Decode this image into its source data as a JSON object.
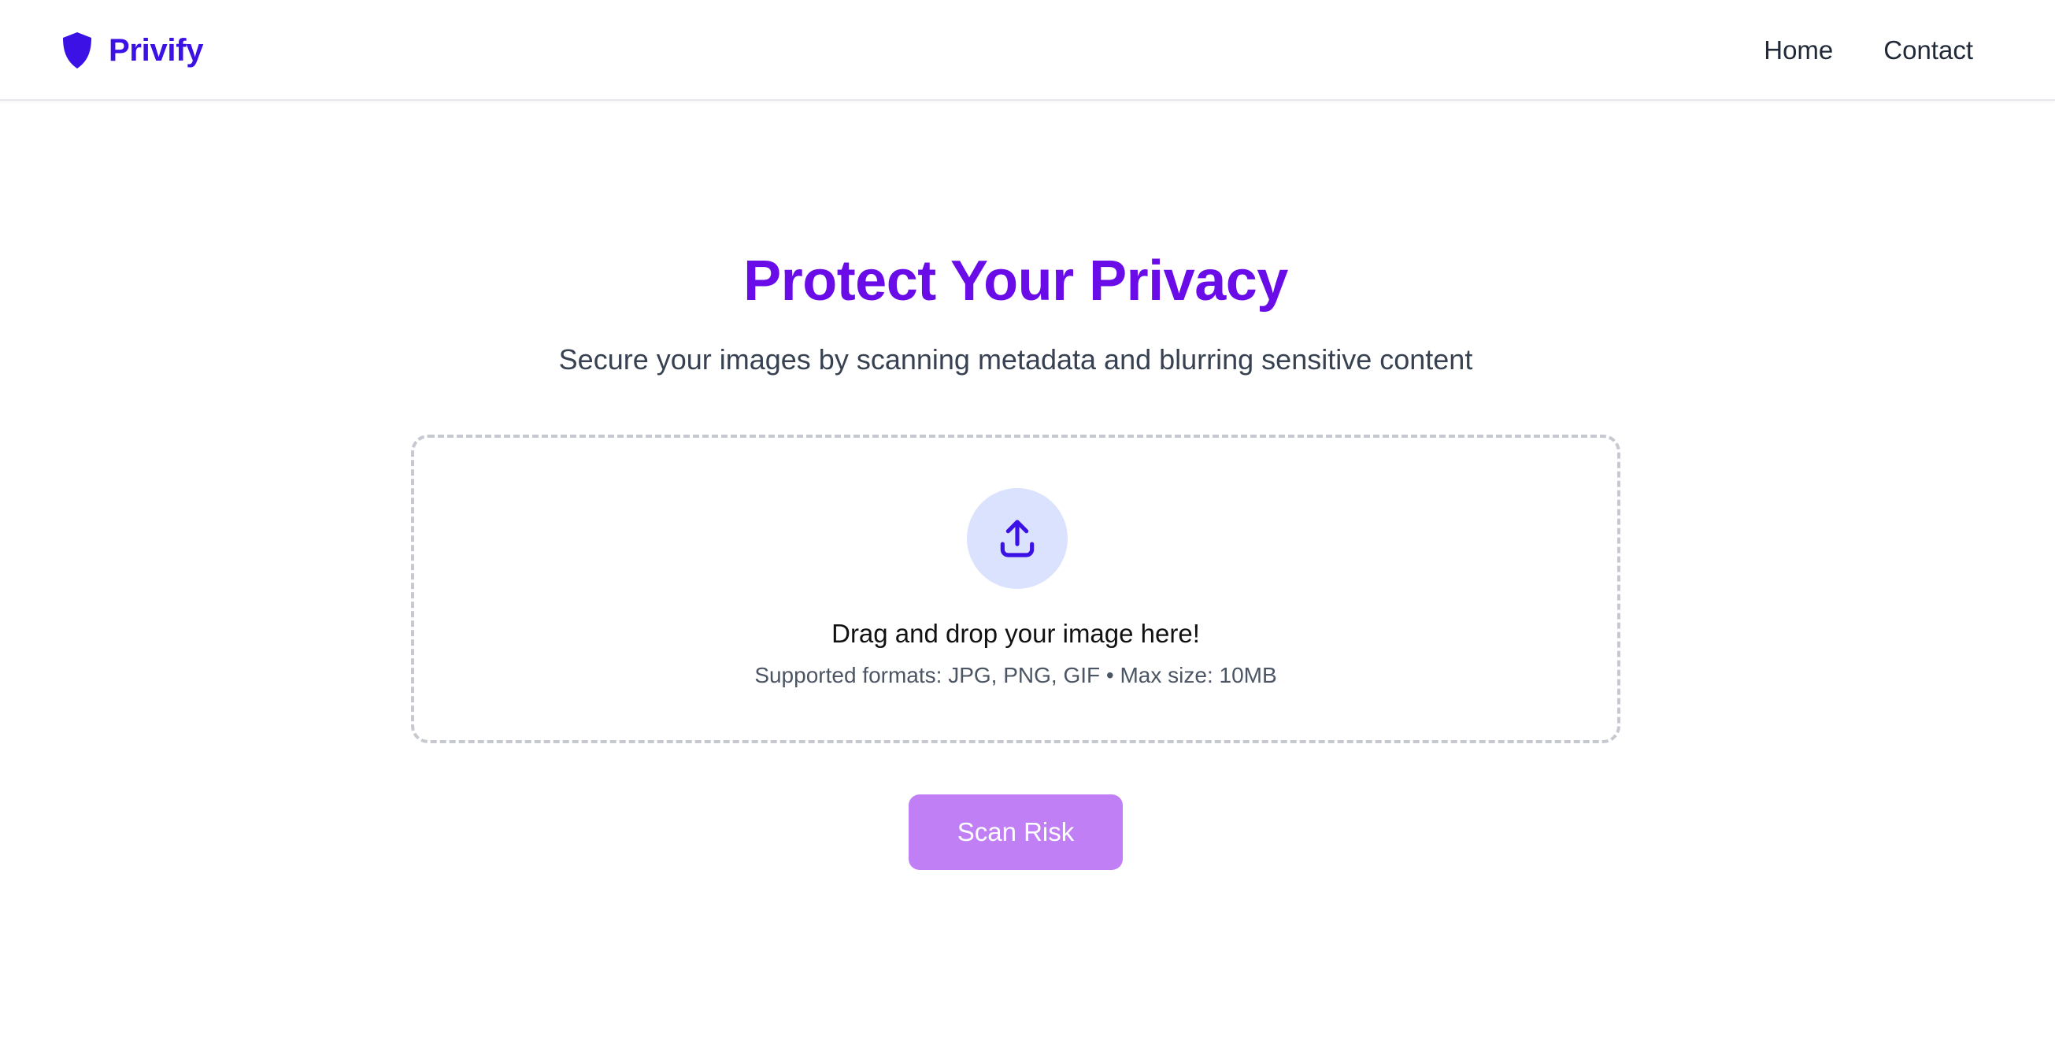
{
  "header": {
    "brand_name": "Privify",
    "brand_icon": "shield-icon",
    "nav": [
      {
        "label": "Home"
      },
      {
        "label": "Contact"
      }
    ]
  },
  "hero": {
    "title": "Protect Your Privacy",
    "subtitle": "Secure your images by scanning metadata and blurring sensitive content"
  },
  "dropzone": {
    "icon": "upload-icon",
    "title": "Drag and drop your image here!",
    "hint": "Supported formats: JPG, PNG, GIF • Max size: 10MB"
  },
  "actions": {
    "scan_label": "Scan Risk"
  },
  "colors": {
    "brand": "#3b11e6",
    "title": "#6a0ce8",
    "button": "#c17ff5",
    "upload_circle": "#dbe2fe",
    "upload_icon": "#3b11e6"
  }
}
